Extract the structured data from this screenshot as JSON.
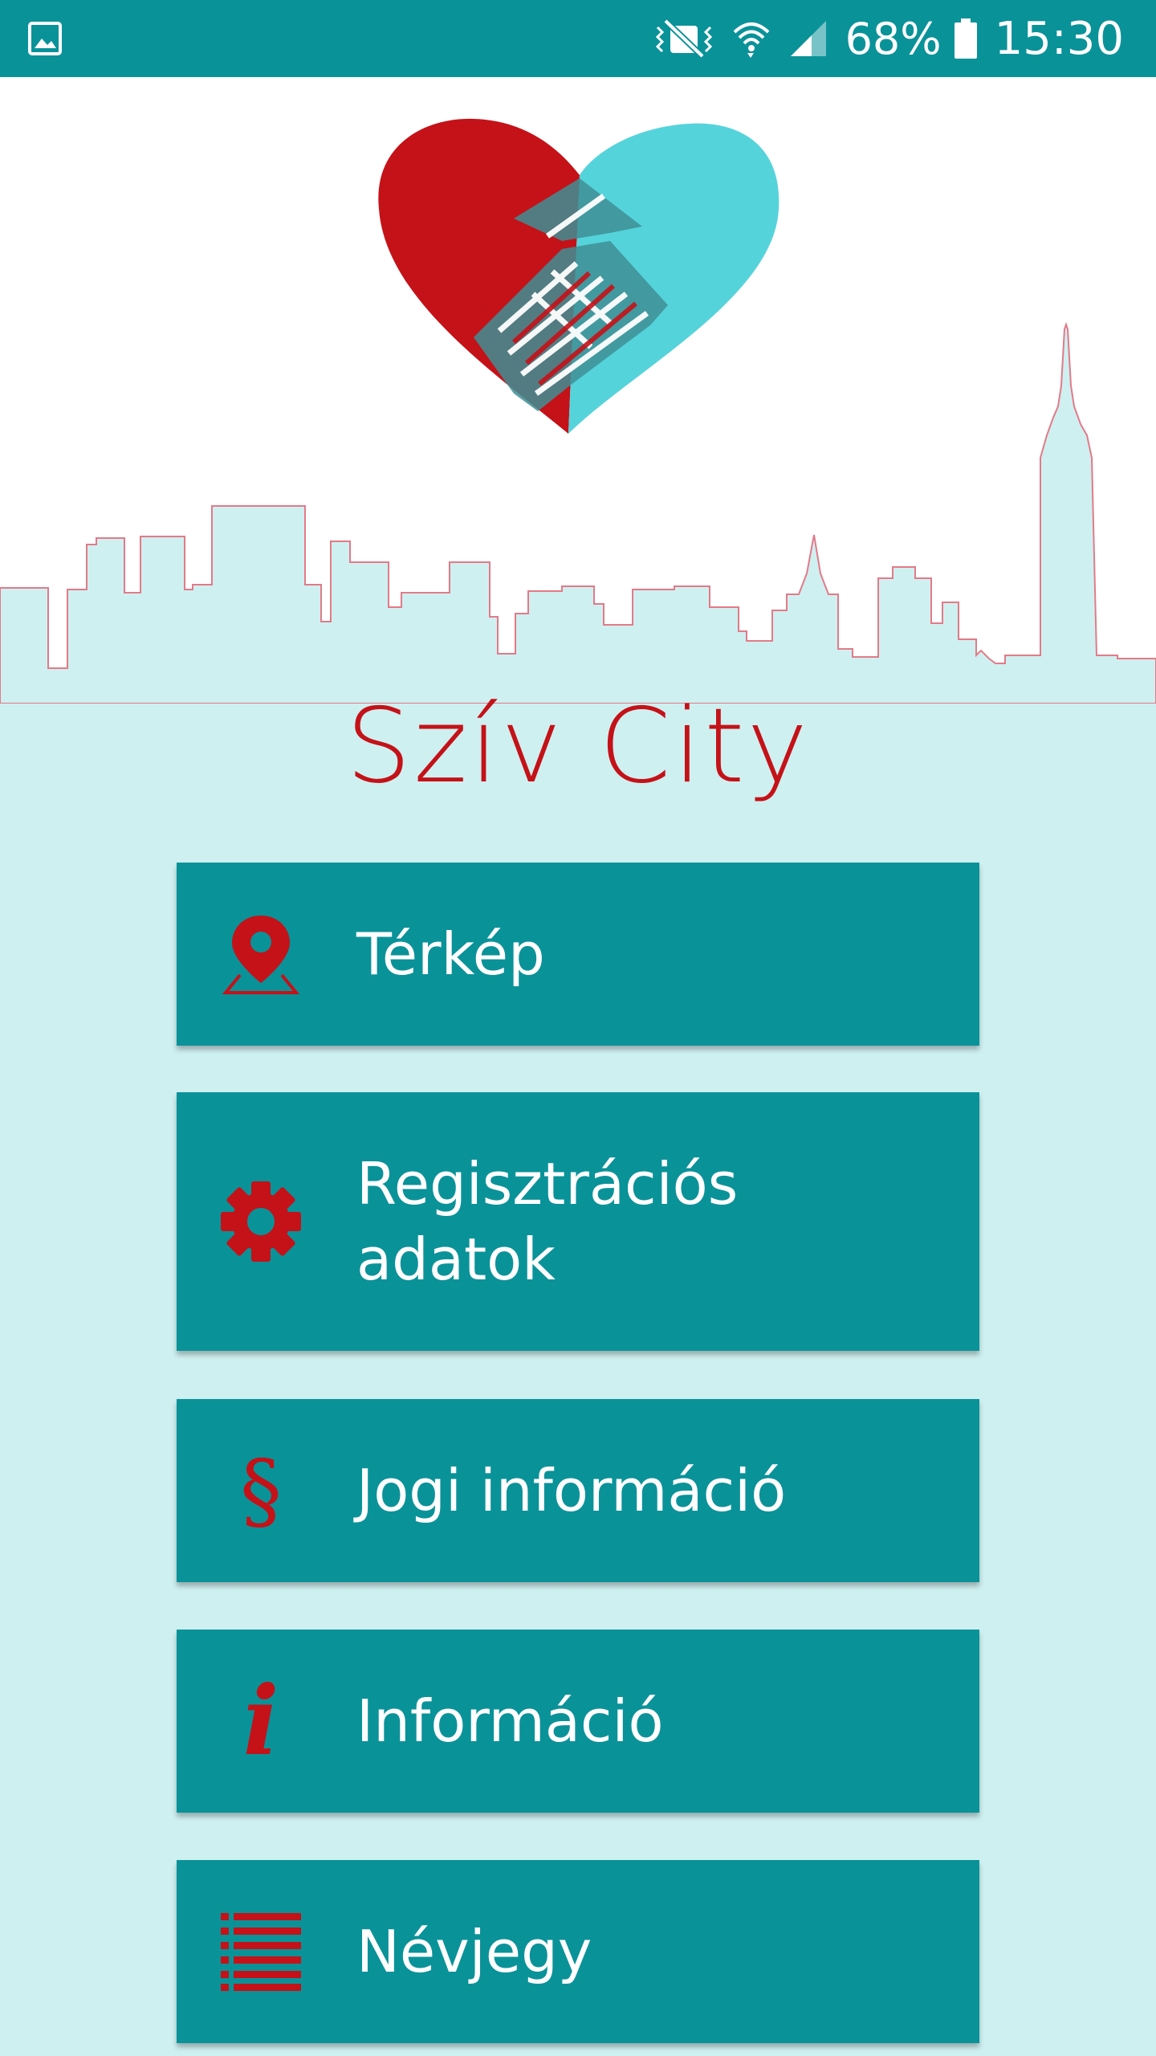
{
  "status_bar": {
    "battery_percent": "68%",
    "clock": "15:30",
    "icons": [
      "gallery-icon",
      "vibrate-icon",
      "wifi-icon",
      "signal-icon",
      "battery-icon"
    ]
  },
  "app": {
    "title": "Szív City",
    "accent_color": "#0a9299",
    "brand_red": "#c41218",
    "background": "#cff0f1"
  },
  "menu": {
    "items": [
      {
        "label": "Térkép",
        "icon": "map-pin-icon"
      },
      {
        "label": "Regisztrációs adatok",
        "icon": "gear-icon"
      },
      {
        "label": "Jogi információ",
        "icon": "section-sign-icon"
      },
      {
        "label": "Információ",
        "icon": "info-icon"
      },
      {
        "label": "Névjegy",
        "icon": "list-icon"
      }
    ]
  }
}
